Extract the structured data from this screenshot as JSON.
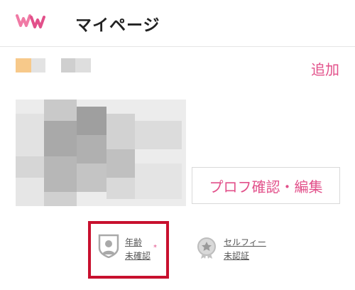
{
  "header": {
    "logo_icon": "ww-logo-icon",
    "title": "マイページ"
  },
  "actions": {
    "add_label": "追加",
    "profile_edit_label": "プロフ確認・編集"
  },
  "verification": {
    "age": {
      "icon": "shield-user-icon",
      "line1": "年齢",
      "line2": "未確認",
      "required_mark": "*"
    },
    "selfie": {
      "icon": "medal-star-icon",
      "line1": "セルフィー",
      "line2": "未認証"
    }
  },
  "colors": {
    "accent": "#e2508a",
    "highlight": "#c8102e",
    "text": "#222222"
  }
}
